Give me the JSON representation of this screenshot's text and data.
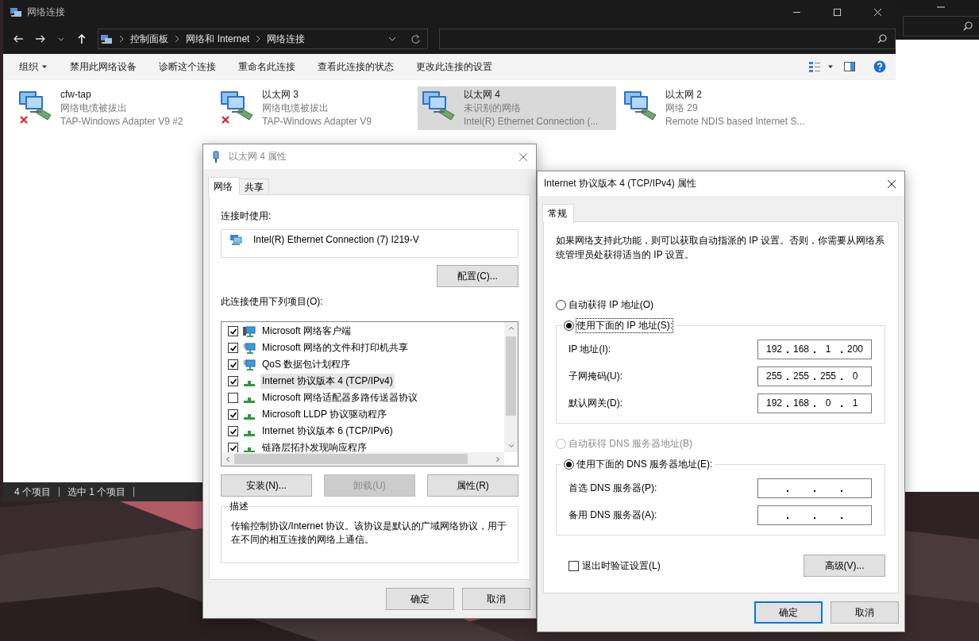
{
  "explorer": {
    "title": "网络连接",
    "breadcrumb": [
      "控制面板",
      "网络和 Internet",
      "网络连接"
    ],
    "commands": [
      {
        "label": "组织",
        "kind": "menu"
      },
      {
        "label": "禁用此网络设备",
        "kind": "action"
      },
      {
        "label": "诊断这个连接",
        "kind": "action"
      },
      {
        "label": "重命名此连接",
        "kind": "action"
      },
      {
        "label": "查看此连接的状态",
        "kind": "action"
      },
      {
        "label": "更改此连接的设置",
        "kind": "action"
      }
    ],
    "adapters": [
      {
        "name": "cfw-tap",
        "status": "网络电缆被拔出",
        "device": "TAP-Windows Adapter V9 #2",
        "disconnected": true,
        "selected": false
      },
      {
        "name": "以太网 3",
        "status": "网络电缆被拔出",
        "device": "TAP-Windows Adapter V9",
        "disconnected": true,
        "selected": false
      },
      {
        "name": "以太网 4",
        "status": "未识别的网络",
        "device": "Intel(R) Ethernet Connection (...",
        "disconnected": false,
        "selected": true
      },
      {
        "name": "以太网 2",
        "status": "网络 29",
        "device": "Remote NDIS based Internet S...",
        "disconnected": false,
        "selected": false
      }
    ],
    "status_bar": [
      "4 个项目",
      "选中 1 个项目"
    ]
  },
  "properties_dialog": {
    "title": "以太网 4 属性",
    "tabs": [
      {
        "label": "网络",
        "selected": true
      },
      {
        "label": "共享",
        "selected": false
      }
    ],
    "connect_using_label": "连接时使用:",
    "adapter": "Intel(R) Ethernet Connection (7) I219-V",
    "configure_button": "配置(C)...",
    "items_label": "此连接使用下列项目(O):",
    "items": [
      {
        "label": "Microsoft 网络客户端",
        "kind": "client",
        "checked": true,
        "selected": false
      },
      {
        "label": "Microsoft 网络的文件和打印机共享",
        "kind": "service",
        "checked": true,
        "selected": false
      },
      {
        "label": "QoS 数据包计划程序",
        "kind": "service",
        "checked": true,
        "selected": false
      },
      {
        "label": "Internet 协议版本 4 (TCP/IPv4)",
        "kind": "protocol",
        "checked": true,
        "selected": true
      },
      {
        "label": "Microsoft 网络适配器多路传送器协议",
        "kind": "protocol",
        "checked": false,
        "selected": false
      },
      {
        "label": "Microsoft LLDP 协议驱动程序",
        "kind": "protocol",
        "checked": true,
        "selected": false
      },
      {
        "label": "Internet 协议版本 6 (TCP/IPv6)",
        "kind": "protocol",
        "checked": true,
        "selected": false
      },
      {
        "label": "链路层拓扑发现响应程序",
        "kind": "protocol",
        "checked": true,
        "selected": false
      }
    ],
    "buttons": [
      {
        "label": "安装(N)...",
        "disabled": false
      },
      {
        "label": "卸载(U)",
        "disabled": true
      },
      {
        "label": "属性(R)",
        "disabled": false
      }
    ],
    "description_title": "描述",
    "description": "传输控制协议/Internet 协议。该协议是默认的广域网络协议，用于在不同的相互连接的网络上通信。",
    "footer_buttons": [
      "确定",
      "取消"
    ]
  },
  "ipv4_dialog": {
    "title": "Internet 协议版本 4 (TCP/IPv4) 属性",
    "tabs": [
      {
        "label": "常规",
        "selected": true
      }
    ],
    "intro": "如果网络支持此功能，则可以获取自动指派的 IP 设置。否则，你需要从网络系统管理员处获得适当的 IP 设置。",
    "ip_mode": [
      {
        "label": "自动获得 IP 地址(O)",
        "selected": false,
        "disabled": false,
        "focused": false
      },
      {
        "label": "使用下面的 IP 地址(S):",
        "selected": true,
        "disabled": false,
        "focused": true
      }
    ],
    "ip_fields": [
      {
        "label": "IP 地址(I):",
        "octets": [
          "192",
          "168",
          "1",
          "200"
        ]
      },
      {
        "label": "子网掩码(U):",
        "octets": [
          "255",
          "255",
          "255",
          "0"
        ]
      },
      {
        "label": "默认网关(D):",
        "octets": [
          "192",
          "168",
          "0",
          "1"
        ]
      }
    ],
    "dns_mode": [
      {
        "label": "自动获得 DNS 服务器地址(B)",
        "selected": false,
        "disabled": true,
        "focused": false
      },
      {
        "label": "使用下面的 DNS 服务器地址(E):",
        "selected": true,
        "disabled": false,
        "focused": false
      }
    ],
    "dns_fields": [
      {
        "label": "首选 DNS 服务器(P):"
      },
      {
        "label": "备用 DNS 服务器(A):"
      }
    ],
    "validate_on_exit": {
      "label": "退出时验证设置(L)",
      "checked": false
    },
    "advanced_button": "高级(V)...",
    "buttons": [
      {
        "label": "确定",
        "default": true
      },
      {
        "label": "取消",
        "default": false
      }
    ]
  }
}
